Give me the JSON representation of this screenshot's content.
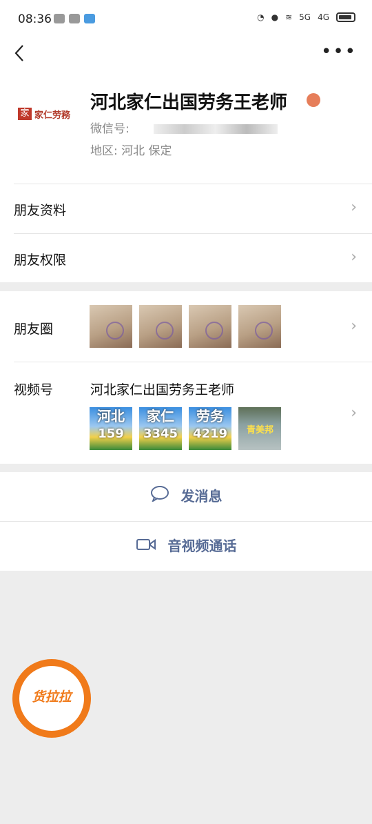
{
  "status": {
    "time": "08:36",
    "signal1": "5G",
    "signal2": "4G"
  },
  "profile": {
    "name": "河北家仁出国劳务王老师",
    "wechat_id_label": "微信号:",
    "region_label": "地区:",
    "region_value": "河北  保定",
    "logo_text": "家仁劳務",
    "logo_box": "家"
  },
  "rows": {
    "friend_info": "朋友资料",
    "friend_permissions": "朋友权限",
    "moments": "朋友圈",
    "channels": "视频号",
    "channels_name": "河北家仁出国劳务王老师"
  },
  "channel_thumbs": [
    {
      "line1": "河北",
      "line2": "159"
    },
    {
      "line1": "家仁",
      "line2": "3345"
    },
    {
      "line1": "劳务",
      "line2": "4219"
    },
    {
      "line1": "青美邦",
      "line2": ""
    }
  ],
  "actions": {
    "message": "发消息",
    "video_call": "音视频通话"
  },
  "floating_button": {
    "label": "货拉拉"
  },
  "colors": {
    "link": "#576b95",
    "accent": "#f07a1a"
  }
}
